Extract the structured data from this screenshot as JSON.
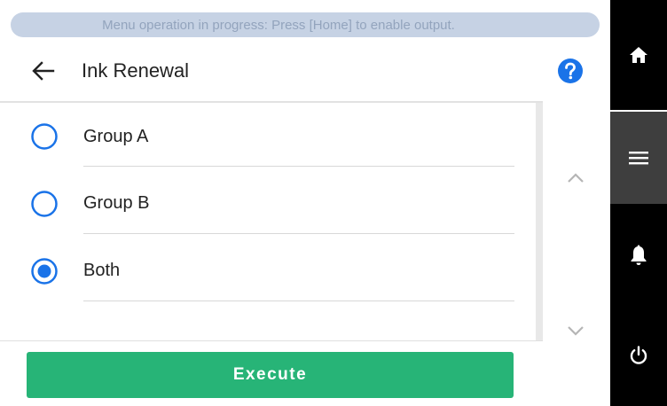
{
  "status_banner": {
    "text": "Menu operation in progress: Press [Home] to enable output."
  },
  "header": {
    "title": "Ink Renewal"
  },
  "options": [
    {
      "label": "Group A",
      "selected": false
    },
    {
      "label": "Group B",
      "selected": false
    },
    {
      "label": "Both",
      "selected": true
    }
  ],
  "execute_button": {
    "label": "Execute"
  },
  "colors": {
    "accent": "#1a73e8",
    "execute": "#27b477",
    "status_pill": "#c6d2e4",
    "status_text": "#93a4bd",
    "sidebar": "#000000",
    "sidebar_active": "#3e3e3e"
  },
  "icons": {
    "back": "arrow-left",
    "help": "question-circle",
    "scroll_up": "chevron-up",
    "scroll_down": "chevron-down",
    "nav_home": "home",
    "nav_menu": "hamburger-menu",
    "nav_notifications": "bell",
    "nav_power": "power"
  }
}
